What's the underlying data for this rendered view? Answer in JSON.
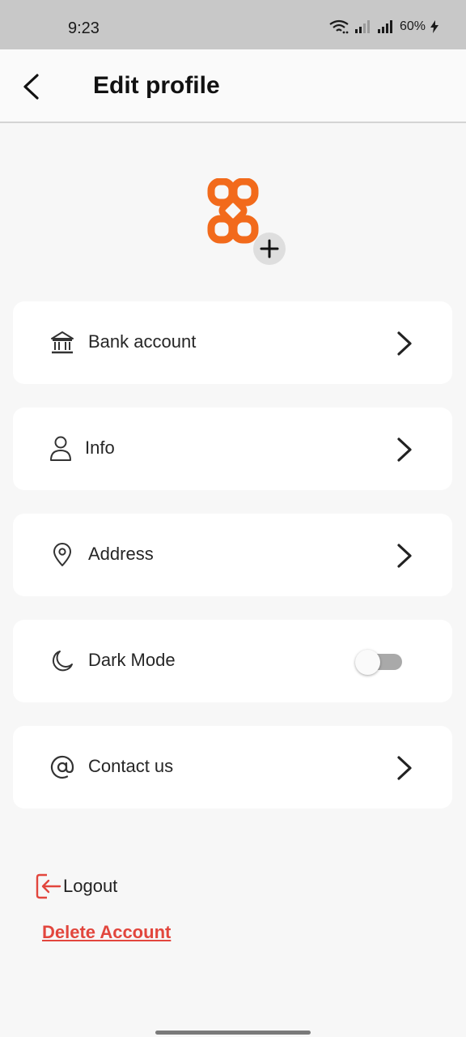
{
  "status_bar": {
    "time": "9:23",
    "battery": "60%",
    "icons": [
      "wifi-icon",
      "signal-icon",
      "signal-icon",
      "charging-icon"
    ]
  },
  "header": {
    "title": "Edit profile",
    "back_icon": "chevron-left-icon"
  },
  "profile": {
    "logo_icon": "brand-logo-icon",
    "add_icon": "plus-icon",
    "brand_color": "#f26a1b"
  },
  "menu": [
    {
      "label": "Bank account",
      "icon": "bank-icon",
      "action": "chevron"
    },
    {
      "label": "Info",
      "icon": "user-icon",
      "action": "chevron"
    },
    {
      "label": "Address",
      "icon": "location-pin-icon",
      "action": "chevron"
    },
    {
      "label": "Dark Mode",
      "icon": "moon-icon",
      "action": "toggle",
      "toggle_on": false
    },
    {
      "label": "Contact us",
      "icon": "at-sign-icon",
      "action": "chevron"
    }
  ],
  "footer": {
    "logout_label": "Logout",
    "logout_icon": "logout-icon",
    "delete_label": "Delete Account",
    "logout_color": "#e2463d",
    "delete_color": "#e2463d"
  }
}
